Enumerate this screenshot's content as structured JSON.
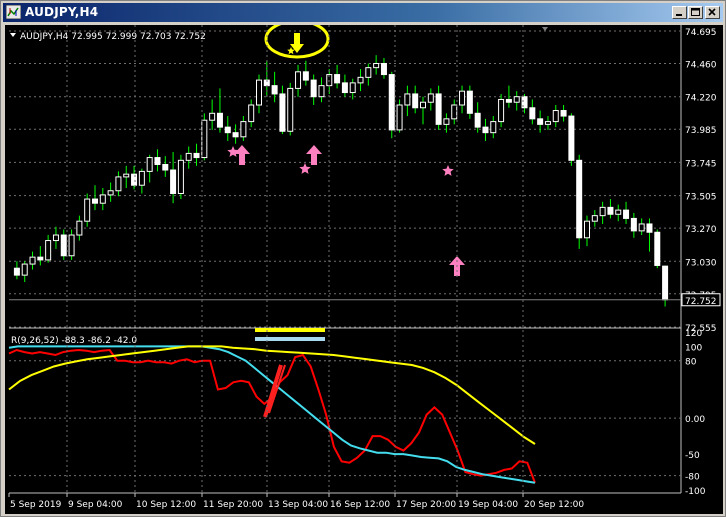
{
  "window": {
    "title": "AUDJPY,H4"
  },
  "chart_header": "AUDJPY,H4  72.995 72.999 72.703 72.752",
  "indicator_header": "R(9,26,52) -88.3 -86.2 -42.0",
  "price_label": "72.752",
  "colors": {
    "background": "#000000",
    "bull": "#ffffff",
    "bear": "#ffffff",
    "wick": "#00ff00",
    "red": "#ff0000",
    "cyan": "#44ddee",
    "yellow": "#ffff00",
    "pink": "#ff80c0",
    "grid": "#6f6f6f"
  },
  "chart_data": [
    {
      "type": "candlestick",
      "title": "AUDJPY,H4",
      "y_ticks": [
        "74.695",
        "74.460",
        "74.220",
        "73.985",
        "73.745",
        "73.505",
        "73.270",
        "73.030",
        "72.795",
        "72.555"
      ],
      "ylim": [
        72.555,
        74.695
      ],
      "candles": [
        [
          72.98,
          73.03,
          72.9,
          72.93
        ],
        [
          72.93,
          73.03,
          72.88,
          73.01
        ],
        [
          73.01,
          73.1,
          72.97,
          73.06
        ],
        [
          73.06,
          73.14,
          73.0,
          73.04
        ],
        [
          73.04,
          73.22,
          73.02,
          73.18
        ],
        [
          73.18,
          73.28,
          73.12,
          73.22
        ],
        [
          73.22,
          73.26,
          73.04,
          73.07
        ],
        [
          73.07,
          73.26,
          73.04,
          73.22
        ],
        [
          73.22,
          73.36,
          73.18,
          73.32
        ],
        [
          73.32,
          73.52,
          73.28,
          73.48
        ],
        [
          73.48,
          73.58,
          73.4,
          73.45
        ],
        [
          73.45,
          73.56,
          73.4,
          73.51
        ],
        [
          73.51,
          73.6,
          73.46,
          73.54
        ],
        [
          73.54,
          73.68,
          73.5,
          73.64
        ],
        [
          73.64,
          73.72,
          73.56,
          73.66
        ],
        [
          73.66,
          73.72,
          73.55,
          73.58
        ],
        [
          73.58,
          73.7,
          73.52,
          73.68
        ],
        [
          73.68,
          73.8,
          73.6,
          73.78
        ],
        [
          73.78,
          73.84,
          73.68,
          73.73
        ],
        [
          73.73,
          73.79,
          73.64,
          73.69
        ],
        [
          73.69,
          73.82,
          73.45,
          73.52
        ],
        [
          73.52,
          73.8,
          73.48,
          73.76
        ],
        [
          73.76,
          73.86,
          73.7,
          73.81
        ],
        [
          73.81,
          73.88,
          73.72,
          73.78
        ],
        [
          73.78,
          74.1,
          73.76,
          74.05
        ],
        [
          74.05,
          74.2,
          73.98,
          74.1
        ],
        [
          74.1,
          74.28,
          73.96,
          74.0
        ],
        [
          74.0,
          74.08,
          73.9,
          73.96
        ],
        [
          73.96,
          74.02,
          73.88,
          73.93
        ],
        [
          73.93,
          74.08,
          73.9,
          74.04
        ],
        [
          74.04,
          74.2,
          74.0,
          74.16
        ],
        [
          74.16,
          74.38,
          74.1,
          74.34
        ],
        [
          74.34,
          74.48,
          74.22,
          74.3
        ],
        [
          74.3,
          74.4,
          74.18,
          74.24
        ],
        [
          74.24,
          74.3,
          73.95,
          73.97
        ],
        [
          73.97,
          74.32,
          73.94,
          74.28
        ],
        [
          74.28,
          74.45,
          74.22,
          74.4
        ],
        [
          74.4,
          74.48,
          74.3,
          74.34
        ],
        [
          74.34,
          74.38,
          74.16,
          74.22
        ],
        [
          74.22,
          74.36,
          74.18,
          74.3
        ],
        [
          74.3,
          74.42,
          74.24,
          74.38
        ],
        [
          74.38,
          74.45,
          74.28,
          74.32
        ],
        [
          74.32,
          74.38,
          74.22,
          74.25
        ],
        [
          74.25,
          74.35,
          74.2,
          74.32
        ],
        [
          74.32,
          74.42,
          74.26,
          74.36
        ],
        [
          74.36,
          74.46,
          74.3,
          74.43
        ],
        [
          74.43,
          74.52,
          74.38,
          74.46
        ],
        [
          74.46,
          74.5,
          74.35,
          74.38
        ],
        [
          74.38,
          74.4,
          73.92,
          73.98
        ],
        [
          73.98,
          74.2,
          73.96,
          74.16
        ],
        [
          74.16,
          74.3,
          74.08,
          74.24
        ],
        [
          74.24,
          74.3,
          74.1,
          74.14
        ],
        [
          74.14,
          74.22,
          74.02,
          74.18
        ],
        [
          74.18,
          74.28,
          74.12,
          74.24
        ],
        [
          74.24,
          74.3,
          73.98,
          74.02
        ],
        [
          74.02,
          74.1,
          73.96,
          74.06
        ],
        [
          74.06,
          74.2,
          74.02,
          74.16
        ],
        [
          74.16,
          74.3,
          74.1,
          74.26
        ],
        [
          74.26,
          74.3,
          74.06,
          74.1
        ],
        [
          74.1,
          74.18,
          73.96,
          74.0
        ],
        [
          74.0,
          74.06,
          73.9,
          73.96
        ],
        [
          73.96,
          74.08,
          73.92,
          74.04
        ],
        [
          74.04,
          74.24,
          74.0,
          74.2
        ],
        [
          74.2,
          74.3,
          74.14,
          74.18
        ],
        [
          74.18,
          74.26,
          74.12,
          74.22
        ],
        [
          74.22,
          74.24,
          74.1,
          74.14
        ],
        [
          74.14,
          74.2,
          74.02,
          74.06
        ],
        [
          74.06,
          74.12,
          73.96,
          74.02
        ],
        [
          74.02,
          74.08,
          73.98,
          74.04
        ],
        [
          74.04,
          74.16,
          74.0,
          74.12
        ],
        [
          74.12,
          74.16,
          74.04,
          74.08
        ],
        [
          74.08,
          74.1,
          73.72,
          73.76
        ],
        [
          73.76,
          73.8,
          73.12,
          73.2
        ],
        [
          73.2,
          73.36,
          73.14,
          73.32
        ],
        [
          73.32,
          73.4,
          73.28,
          73.36
        ],
        [
          73.36,
          73.46,
          73.3,
          73.42
        ],
        [
          73.42,
          73.48,
          73.34,
          73.37
        ],
        [
          73.37,
          73.44,
          73.32,
          73.4
        ],
        [
          73.4,
          73.46,
          73.3,
          73.34
        ],
        [
          73.34,
          73.38,
          73.2,
          73.25
        ],
        [
          73.25,
          73.34,
          73.22,
          73.3
        ],
        [
          73.3,
          73.34,
          73.1,
          73.24
        ],
        [
          73.24,
          73.26,
          72.98,
          73.0
        ],
        [
          72.995,
          72.999,
          72.703,
          72.752
        ]
      ],
      "last_price": 72.752
    },
    {
      "type": "line",
      "ylabel_ticks": [
        "120",
        "100",
        "80",
        "0.00",
        "-50",
        "-80",
        "-100"
      ],
      "ylim": [
        -100,
        120
      ],
      "series": [
        {
          "name": "R(9)",
          "color": "#ff0000",
          "values": [
            90,
            95,
            92,
            90,
            92,
            90,
            88,
            92,
            94,
            95,
            94,
            92,
            94,
            95,
            80,
            80,
            78,
            78,
            80,
            78,
            78,
            76,
            80,
            82,
            78,
            80,
            80,
            40,
            42,
            50,
            52,
            50,
            30,
            20,
            28,
            50,
            60,
            85,
            88,
            72,
            40,
            5,
            -40,
            -60,
            -62,
            -55,
            -45,
            -25,
            -25,
            -30,
            -40,
            -45,
            -35,
            -20,
            5,
            15,
            5,
            -20,
            -45,
            -75,
            -78,
            -80,
            -78,
            -76,
            -72,
            -70,
            -60,
            -62,
            -90
          ]
        },
        {
          "name": "R(26)",
          "color": "#44ddee",
          "values": [
            98,
            100,
            100,
            100,
            100,
            100,
            100,
            100,
            100,
            100,
            100,
            100,
            100,
            100,
            100,
            100,
            100,
            100,
            100,
            100,
            100,
            100,
            100,
            98,
            96,
            92,
            86,
            80,
            70,
            60,
            50,
            40,
            30,
            20,
            10,
            0,
            -10,
            -20,
            -30,
            -38,
            -42,
            -45,
            -48,
            -48,
            -50,
            -50,
            -52,
            -54,
            -55,
            -56,
            -60,
            -68,
            -72,
            -75,
            -78,
            -80,
            -82,
            -84,
            -86,
            -88,
            -90
          ]
        },
        {
          "name": "R(52)",
          "color": "#ffff00",
          "values": [
            40,
            52,
            60,
            66,
            72,
            76,
            79,
            82,
            84,
            86,
            88,
            90,
            92,
            94,
            96,
            98,
            100,
            100,
            100,
            100,
            98,
            97,
            96,
            94,
            93,
            92,
            91,
            90,
            89,
            88,
            86,
            84,
            82,
            80,
            78,
            76,
            74,
            70,
            64,
            56,
            46,
            34,
            22,
            10,
            -2,
            -14,
            -26,
            -36
          ]
        }
      ]
    }
  ],
  "x_ticks": [
    "5 Sep 2019",
    "9 Sep 04:00",
    "10 Sep 12:00",
    "11 Sep 20:00",
    "13 Sep 04:00",
    "16 Sep 12:00",
    "17 Sep 20:00",
    "19 Sep 04:00",
    "20 Sep 12:00"
  ]
}
